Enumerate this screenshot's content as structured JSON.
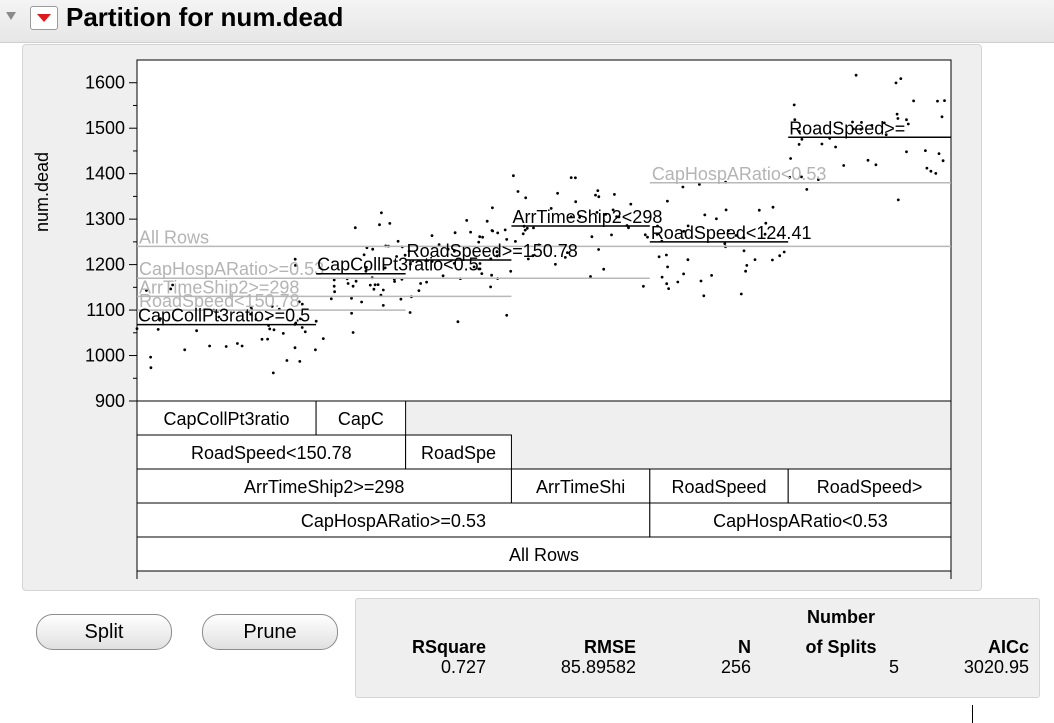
{
  "header": {
    "title": "Partition for num.dead"
  },
  "chart_data": {
    "type": "scatter",
    "ylabel": "num.dead",
    "ylim": [
      900,
      1650
    ],
    "yticks": [
      900,
      1000,
      1100,
      1200,
      1300,
      1400,
      1500,
      1600
    ],
    "n_points": 256,
    "leaves": [
      {
        "label": "CapCollPt3ratio>=0.5",
        "x0": 0,
        "x1": 0.22,
        "mean": 1068
      },
      {
        "label": "CapCollPt3ratio<0.5",
        "x0": 0.22,
        "x1": 0.33,
        "mean": 1180
      },
      {
        "label": "RoadSpeed>=150.78",
        "x0": 0.33,
        "x1": 0.46,
        "mean": 1210
      },
      {
        "label": "ArrTimeShip2<298",
        "x0": 0.46,
        "x1": 0.63,
        "mean": 1285
      },
      {
        "label": "RoadSpeed<124.41",
        "x0": 0.63,
        "x1": 0.8,
        "mean": 1250
      },
      {
        "label": "RoadSpeed>=",
        "x0": 0.8,
        "x1": 1.0,
        "mean": 1480
      }
    ],
    "parent_lines": [
      {
        "label": "All Rows",
        "x0": 0,
        "x1": 1.0,
        "mean": 1240
      },
      {
        "label": "CapHospARatio>=0.53",
        "x0": 0,
        "x1": 0.63,
        "mean": 1170
      },
      {
        "label": "ArrTimeShip2>=298",
        "x0": 0,
        "x1": 0.46,
        "mean": 1130
      },
      {
        "label": "RoadSpeed<150.78",
        "x0": 0,
        "x1": 0.33,
        "mean": 1100
      },
      {
        "label": "CapHospARatio<0.53",
        "x0": 0.63,
        "x1": 1.0,
        "mean": 1380
      }
    ],
    "tree_rows": [
      [
        {
          "label": "CapCollPt3ratio",
          "x0": 0,
          "x1": 0.22
        },
        {
          "label": "CapC",
          "x0": 0.22,
          "x1": 0.33
        }
      ],
      [
        {
          "label": "RoadSpeed<150.78",
          "x0": 0,
          "x1": 0.33
        },
        {
          "label": "RoadSpe",
          "x0": 0.33,
          "x1": 0.46
        }
      ],
      [
        {
          "label": "ArrTimeShip2>=298",
          "x0": 0,
          "x1": 0.46
        },
        {
          "label": "ArrTimeShi",
          "x0": 0.46,
          "x1": 0.63
        },
        {
          "label": "RoadSpeed",
          "x0": 0.63,
          "x1": 0.8
        },
        {
          "label": "RoadSpeed>",
          "x0": 0.8,
          "x1": 1.0
        }
      ],
      [
        {
          "label": "CapHospARatio>=0.53",
          "x0": 0,
          "x1": 0.63
        },
        {
          "label": "CapHospARatio<0.53",
          "x0": 0.63,
          "x1": 1.0
        }
      ],
      [
        {
          "label": "All Rows",
          "x0": 0,
          "x1": 1.0
        }
      ]
    ]
  },
  "buttons": {
    "split": "Split",
    "prune": "Prune"
  },
  "stats": {
    "rsquare_label": "RSquare",
    "rsquare": "0.727",
    "rmse_label": "RMSE",
    "rmse": "85.89582",
    "n_label": "N",
    "n": "256",
    "splits_label_1": "Number",
    "splits_label_2": "of Splits",
    "splits": "5",
    "aicc_label": "AICc",
    "aicc": "3020.95"
  }
}
